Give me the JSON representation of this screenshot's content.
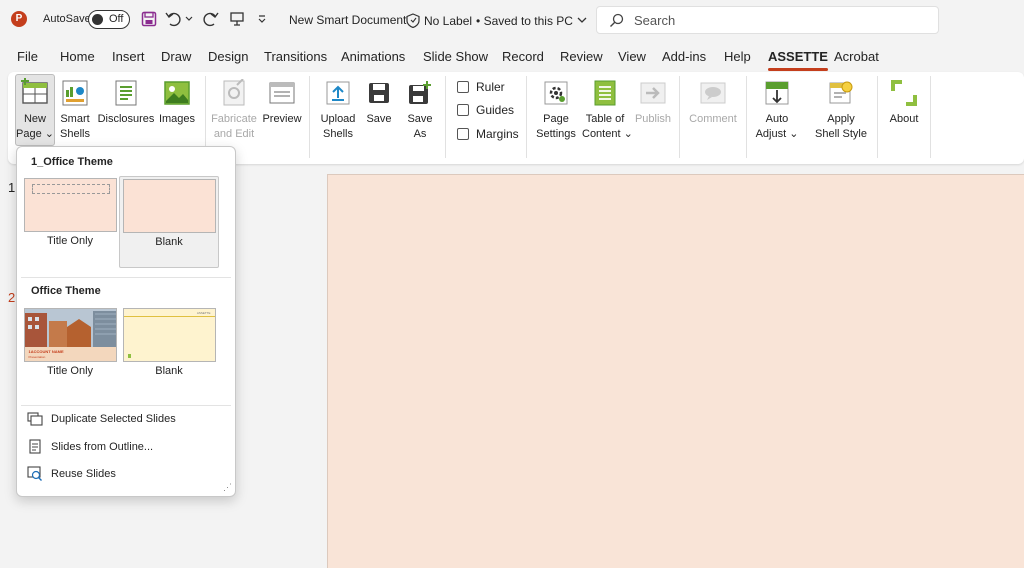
{
  "titlebar": {
    "app_icon": "powerpoint-icon",
    "app_letter": "P",
    "autosave_label": "AutoSave",
    "autosave_state": "Off",
    "doc_title": "New Smart Document",
    "sensitivity_label": "No Label",
    "save_status": "• Saved to this PC",
    "search_placeholder": "Search"
  },
  "menu": {
    "items": [
      "File",
      "Home",
      "Insert",
      "Draw",
      "Design",
      "Transitions",
      "Animations",
      "Slide Show",
      "Record",
      "Review",
      "View",
      "Add-ins",
      "Help",
      "ASSETTE",
      "Acrobat"
    ],
    "active": "ASSETTE"
  },
  "ribbon": {
    "new_page": [
      "New",
      "Page ⌄"
    ],
    "smart_shells": [
      "Smart",
      "Shells"
    ],
    "disclosures": "Disclosures",
    "images": "Images",
    "fabricate": [
      "Fabricate",
      "and Edit"
    ],
    "preview": "Preview",
    "upload_shells": [
      "Upload",
      "Shells"
    ],
    "save": "Save",
    "save_as": [
      "Save",
      "As"
    ],
    "ruler": "Ruler",
    "guides": "Guides",
    "margins": "Margins",
    "page_settings": [
      "Page",
      "Settings"
    ],
    "table_of_content": [
      "Table of",
      "Content ⌄"
    ],
    "publish": "Publish",
    "comment": "Comment",
    "auto_adjust": [
      "Auto",
      "Adjust ⌄"
    ],
    "apply_shell_style": [
      "Apply",
      "Shell Style"
    ],
    "about": "About"
  },
  "thumbnails": {
    "numbers": [
      "1",
      "2"
    ]
  },
  "dropdown": {
    "section1_title": "1_Office Theme",
    "section1_layouts": [
      "Title Only",
      "Blank"
    ],
    "section2_title": "Office Theme",
    "section2_layouts": [
      "Title Only",
      "Blank"
    ],
    "thumb_text": "1ACCOUNT NAME",
    "thumb_subtext": "Presentation",
    "thumb_corner": "ASSETTE",
    "actions": [
      "Duplicate Selected Slides",
      "Slides from Outline...",
      "Reuse Slides"
    ]
  },
  "colors": {
    "accent": "#c43e1c",
    "slide_background": "#f9e4d7",
    "blank_layout_fill": "#fef3cf"
  }
}
